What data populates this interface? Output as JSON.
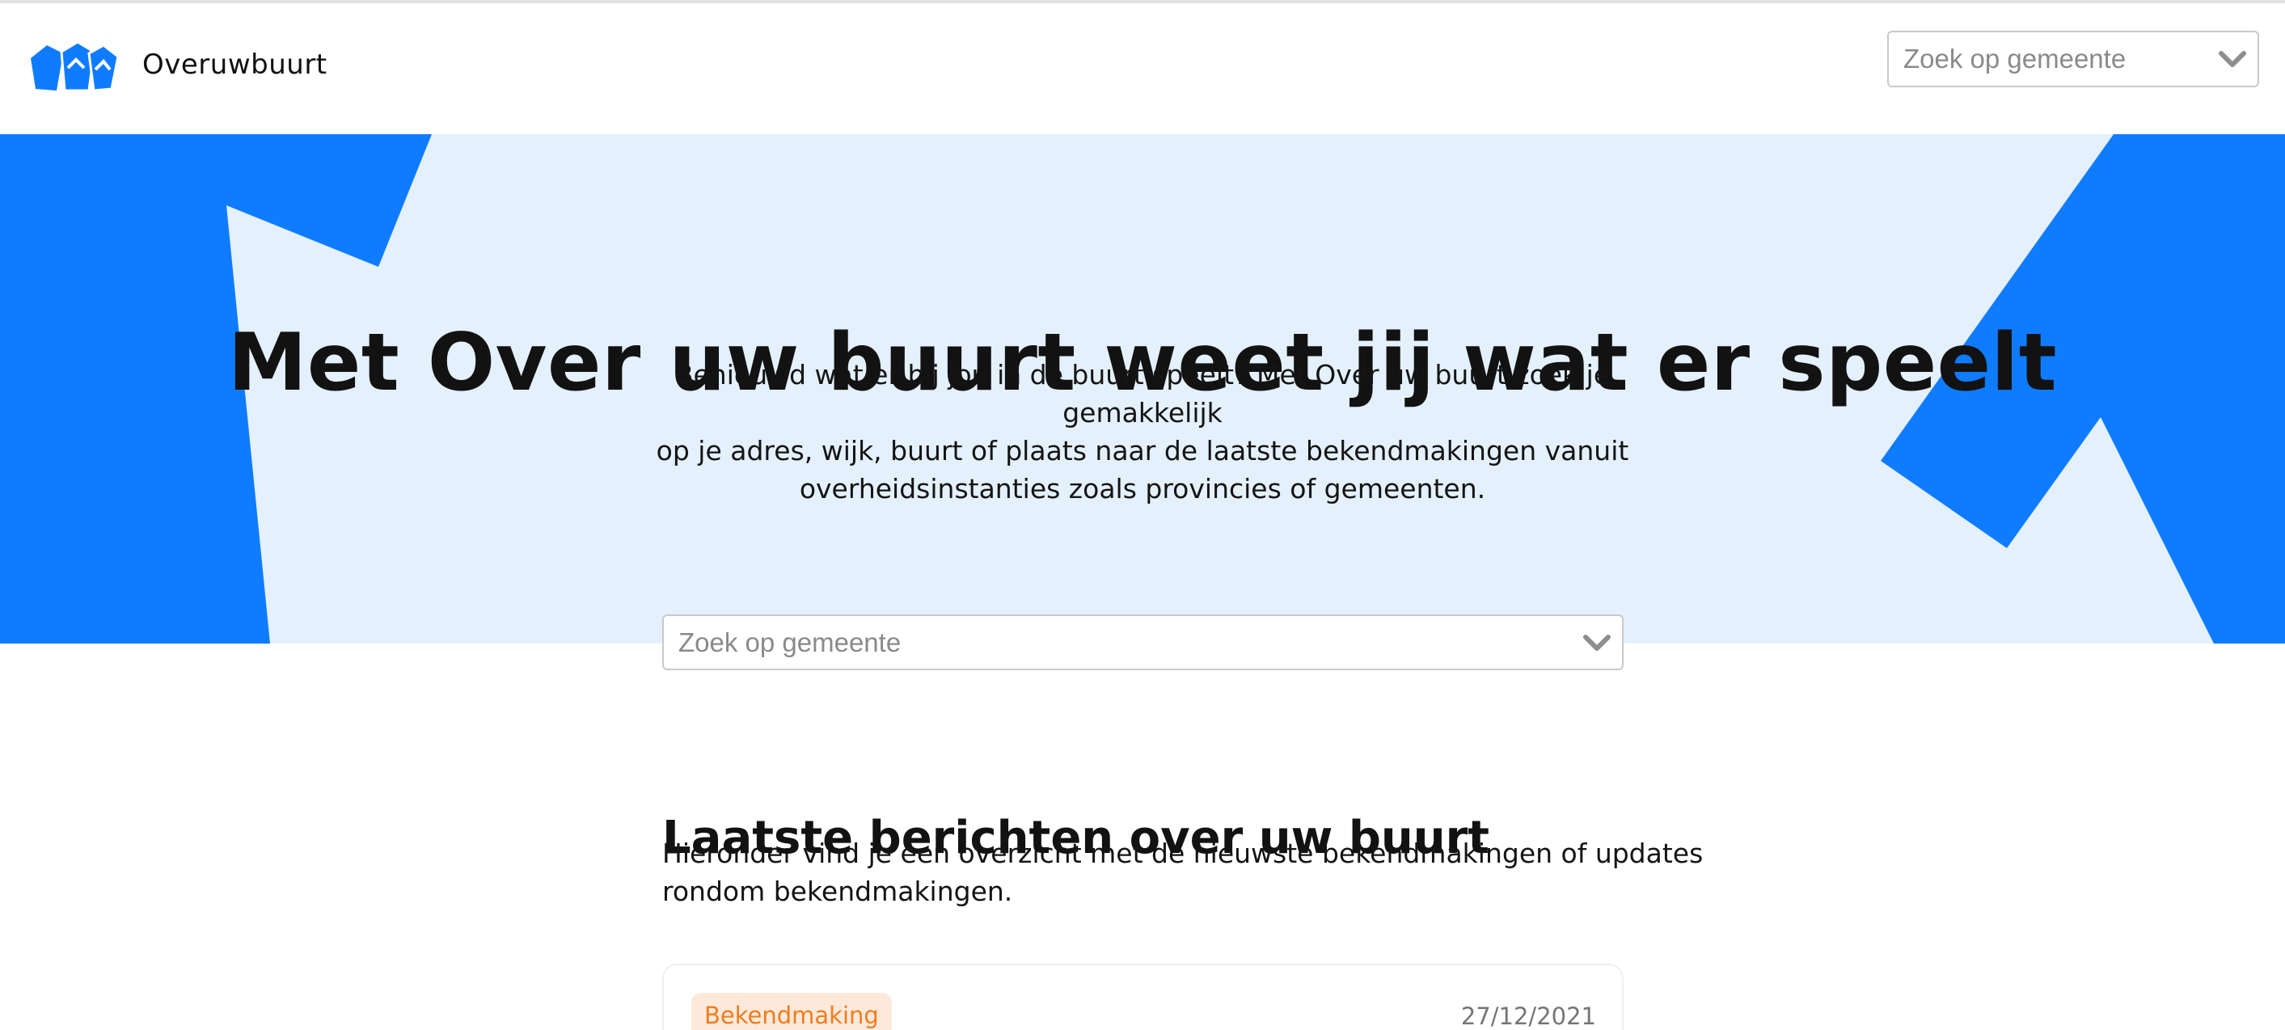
{
  "header": {
    "brand": "Overuwbuurt",
    "search": {
      "placeholder": "Zoek op gemeente"
    }
  },
  "hero": {
    "title": "Met Over uw buurt weet jij wat er speelt",
    "text_lines": [
      "Benieuwd wat er bij jou in de buurt speelt? Met Over uw buurt zoek je gemakkelijk",
      "op je adres, wijk, buurt of plaats naar de laatste bekendmakingen vanuit",
      "overheidsinstanties zoals provincies of gemeenten."
    ],
    "search": {
      "placeholder": "Zoek op gemeente"
    }
  },
  "latest": {
    "title": "Laatste berichten over uw buurt",
    "text_lines": [
      "Hieronder vind je een overzicht met de nieuwste bekendmakingen of updates",
      "rondom bekendmakingen."
    ],
    "items": [
      {
        "badge": "Bekendmaking",
        "date": "27/12/2021"
      }
    ]
  },
  "colors": {
    "brand_blue": "#0f7cff",
    "hero_background": "#e4f0fc",
    "badge_background": "#fde9da",
    "badge_text": "#f07c1e"
  },
  "icons": {
    "logo": "houses-logo-icon",
    "dropdown": "chevron-down-icon"
  }
}
